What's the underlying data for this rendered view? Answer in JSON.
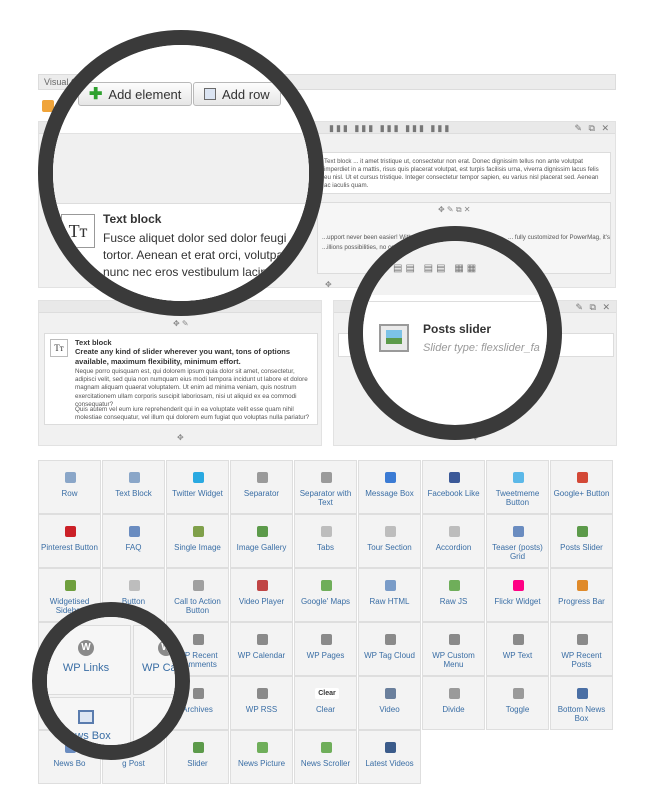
{
  "editor": {
    "tab_label": "Visual C",
    "add_element": "Add element",
    "add_row": "Add row"
  },
  "text_block": {
    "title": "Text block",
    "lines": [
      "Fusce aliquet dolor sed dolor feugi",
      "tortor. Aenean et erat orci, volutpat",
      "nunc nec eros vestibulum lacini"
    ]
  },
  "right_text": {
    "para": "Text block ... it amet tristique ut, consectetur non erat. Donec dignissim tellus non ante volutpat imperdiet in a mattis, risus quis placerat volutpat, est turpis facilisis urna, viverra dignissim lacus felis eu nisl. Ut et cursus tristique. Integer consectetur tempor sapien, eu varius nisl placerat sed. Aenean ac iaculis quam.",
    "line2a": "...upport never been easier! With the P",
    "line2b": "... fully customized for PowerMag, it's",
    "line2c": "...illions possibilities, no code, no"
  },
  "left_block": {
    "title": "Text block",
    "subtitle": "Create any kind of slider wherever you want, tons of options available, maximum flexibility, minimum effort.",
    "body1": "Neque porro quisquam est, qui dolorem ipsum quia dolor sit amet, consectetur, adipisci velit, sed quia non numquam eius modi tempora incidunt ut labore et dolore magnam aliquam quaerat voluptatem. Ut enim ad minima veniam, quis nostrum exercitationem ullam corporis suscipit laboriosam, nisi ut aliquid ex ea commodi consequatur?",
    "body2": "Quis autem vel eum iure reprehenderit qui in ea voluptate velit esse quam nihil molestiae consequatur, vel illum qui dolorem eum fugiat quo voluptas nulla pariatur?"
  },
  "posts_slider": {
    "title": "Posts slider",
    "subtitle": "Slider type: flexslider_fa"
  },
  "elements": [
    {
      "label": "Row",
      "icon": "row-icon",
      "color": "#8aa6c8"
    },
    {
      "label": "Text Block",
      "icon": "text-icon",
      "color": "#8aa6c8"
    },
    {
      "label": "Twitter Widget",
      "icon": "twitter-icon",
      "color": "#29a9e1"
    },
    {
      "label": "Separator",
      "icon": "separator-icon",
      "color": "#9a9a9a"
    },
    {
      "label": "Separator with Text",
      "icon": "separator-text-icon",
      "color": "#9a9a9a"
    },
    {
      "label": "Message Box",
      "icon": "info-icon",
      "color": "#3b7bd4"
    },
    {
      "label": "Facebook Like",
      "icon": "facebook-icon",
      "color": "#3b5998"
    },
    {
      "label": "Tweetmeme Button",
      "icon": "tweetmeme-icon",
      "color": "#5bb8e8"
    },
    {
      "label": "Google+ Button",
      "icon": "google-plus-icon",
      "color": "#d34836"
    },
    {
      "label": "Pinterest Button",
      "icon": "pinterest-icon",
      "color": "#cb2027"
    },
    {
      "label": "FAQ",
      "icon": "faq-icon",
      "color": "#6a8cc0"
    },
    {
      "label": "Single Image",
      "icon": "image-icon",
      "color": "#7fa04a"
    },
    {
      "label": "Image Gallery",
      "icon": "gallery-icon",
      "color": "#5c9a4a"
    },
    {
      "label": "Tabs",
      "icon": "tabs-icon",
      "color": "#bdbdbd"
    },
    {
      "label": "Tour Section",
      "icon": "tour-icon",
      "color": "#bdbdbd"
    },
    {
      "label": "Accordion",
      "icon": "accordion-icon",
      "color": "#bdbdbd"
    },
    {
      "label": "Teaser (posts) Grid",
      "icon": "teaser-grid-icon",
      "color": "#6a8cc0"
    },
    {
      "label": "Posts Slider",
      "icon": "posts-slider-icon",
      "color": "#5c9a4a"
    },
    {
      "label": "Widgetised Sidebar",
      "icon": "sidebar-icon",
      "color": "#6f9f3e"
    },
    {
      "label": "Button",
      "icon": "button-icon",
      "color": "#bdbdbd"
    },
    {
      "label": "Call to Action Button",
      "icon": "cta-icon",
      "color": "#a0a0a0"
    },
    {
      "label": "Video Player",
      "icon": "video-player-icon",
      "color": "#c04545"
    },
    {
      "label": "Google' Maps",
      "icon": "map-icon",
      "color": "#6fae5a"
    },
    {
      "label": "Raw HTML",
      "icon": "raw-html-icon",
      "color": "#7a9cc8"
    },
    {
      "label": "Raw JS",
      "icon": "raw-js-icon",
      "color": "#6fae5a"
    },
    {
      "label": "Flickr Widget",
      "icon": "flickr-icon",
      "color": "#ff0084"
    },
    {
      "label": "Progress Bar",
      "icon": "progress-bar-icon",
      "color": "#e08a2a"
    },
    {
      "label": "WP Links",
      "icon": "wordpress-icon",
      "color": "#8a8a8a"
    },
    {
      "label": "WP Cat",
      "icon": "wordpress-icon",
      "color": "#8a8a8a"
    },
    {
      "label": "WP Recent Comments",
      "icon": "wordpress-icon",
      "color": "#8a8a8a"
    },
    {
      "label": "WP Calendar",
      "icon": "wordpress-icon",
      "color": "#8a8a8a"
    },
    {
      "label": "WP Pages",
      "icon": "wordpress-icon",
      "color": "#8a8a8a"
    },
    {
      "label": "WP Tag Cloud",
      "icon": "wordpress-icon",
      "color": "#8a8a8a"
    },
    {
      "label": "WP Custom Menu",
      "icon": "wordpress-icon",
      "color": "#8a8a8a"
    },
    {
      "label": "WP Text",
      "icon": "wordpress-icon",
      "color": "#8a8a8a"
    },
    {
      "label": "WP Recent Posts",
      "icon": "wordpress-icon",
      "color": "#8a8a8a"
    },
    {
      "label": "News Box",
      "icon": "news-box-icon",
      "color": "#6a8cc0"
    },
    {
      "label": "Blo",
      "icon": "blog-icon",
      "color": "#9a9a9a"
    },
    {
      "label": "Archives",
      "icon": "wordpress-icon",
      "color": "#8a8a8a"
    },
    {
      "label": "WP RSS",
      "icon": "wordpress-icon",
      "color": "#8a8a8a"
    },
    {
      "label": "Clear",
      "icon": "clear-icon",
      "color": "#ffffff"
    },
    {
      "label": "Video",
      "icon": "video-icon",
      "color": "#6a7f9c"
    },
    {
      "label": "Divide",
      "icon": "divide-icon",
      "color": "#9a9a9a"
    },
    {
      "label": "Toggle",
      "icon": "toggle-icon",
      "color": "#9a9a9a"
    },
    {
      "label": "Bottom News Box",
      "icon": "bottom-news-icon",
      "color": "#4a6fa5"
    },
    {
      "label": "News Bo",
      "icon": "news-box-icon",
      "color": "#6a8cc0"
    },
    {
      "label": "g Post",
      "icon": "blog-post-icon",
      "color": "#9a9a9a"
    },
    {
      "label": "Slider",
      "icon": "slider-icon",
      "color": "#5c9a4a"
    },
    {
      "label": "News Picture",
      "icon": "news-picture-icon",
      "color": "#6fae5a"
    },
    {
      "label": "News Scroller",
      "icon": "news-scroller-icon",
      "color": "#6fae5a"
    },
    {
      "label": "Latest Videos",
      "icon": "latest-videos-icon",
      "color": "#3b5b8a"
    }
  ],
  "zoom": {
    "wp_links": "WP Links",
    "wp_cat": "WP Cat",
    "news_box": "News Box",
    "blog": "Blo"
  }
}
